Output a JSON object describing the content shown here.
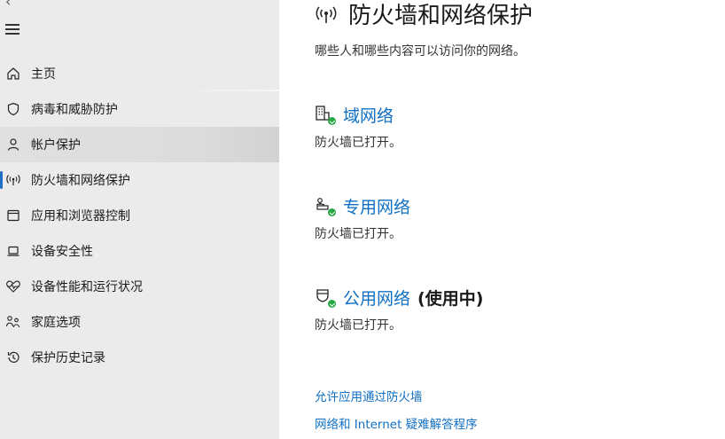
{
  "window": {
    "back_glyph": "‹"
  },
  "sidebar": {
    "items": [
      {
        "label": "主页",
        "icon": "home-icon"
      },
      {
        "label": "病毒和威胁防护",
        "icon": "shield-icon"
      },
      {
        "label": "帐户保护",
        "icon": "person-icon",
        "state": "hover"
      },
      {
        "label": "防火墙和网络保护",
        "icon": "antenna-icon",
        "state": "selected"
      },
      {
        "label": "应用和浏览器控制",
        "icon": "app-browser-icon"
      },
      {
        "label": "设备安全性",
        "icon": "laptop-icon"
      },
      {
        "label": "设备性能和运行状况",
        "icon": "heart-pulse-icon"
      },
      {
        "label": "家庭选项",
        "icon": "family-icon"
      },
      {
        "label": "保护历史记录",
        "icon": "history-icon"
      }
    ]
  },
  "main": {
    "title": "防火墙和网络保护",
    "subtitle": "哪些人和哪些内容可以访问你的网络。",
    "networks": [
      {
        "name": "域网络",
        "suffix": "",
        "status": "防火墙已打开。",
        "icon": "domain-network-icon"
      },
      {
        "name": "专用网络",
        "suffix": "",
        "status": "防火墙已打开。",
        "icon": "private-network-icon"
      },
      {
        "name": "公用网络",
        "suffix": "(使用中)",
        "status": "防火墙已打开。",
        "icon": "public-network-icon"
      }
    ],
    "links": [
      "允许应用通过防火墙",
      "网络和 Internet 疑难解答程序"
    ]
  },
  "colors": {
    "accent": "#1170c4",
    "selected_indicator": "#1f6fc4",
    "check": "#27a844",
    "sidebar_bg": "#ebebeb"
  }
}
